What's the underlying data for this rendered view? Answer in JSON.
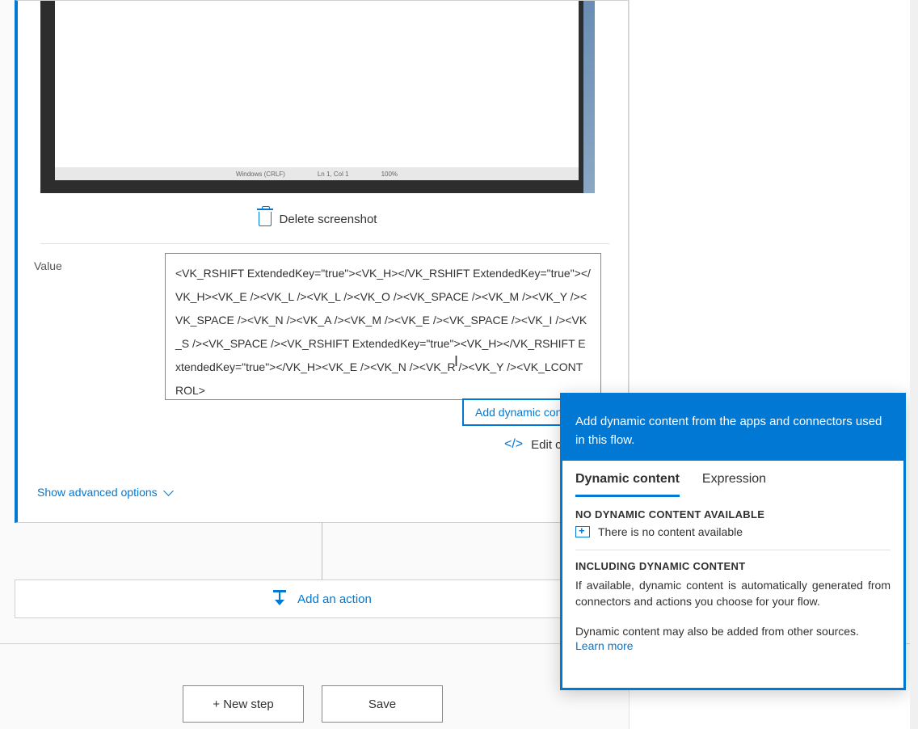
{
  "card": {
    "delete_label": "Delete screenshot",
    "value_label": "Value",
    "value_text": "<VK_RSHIFT ExtendedKey=\"true\"><VK_H></VK_RSHIFT ExtendedKey=\"true\"></VK_H><VK_E /><VK_L /><VK_L /><VK_O /><VK_SPACE /><VK_M /><VK_Y /><VK_SPACE /><VK_N /><VK_A /><VK_M /><VK_E /><VK_SPACE /><VK_I /><VK_S /><VK_SPACE /><VK_RSHIFT ExtendedKey=\"true\"><VK_H></VK_RSHIFT ExtendedKey=\"true\"></VK_H><VK_E /><VK_N /><VK_R /><VK_Y /><VK_LCONTROL>",
    "add_dynamic_content": "Add dynamic cont",
    "edit_code": "Edit co",
    "show_advanced": "Show advanced options",
    "screenshot_status_1": "Windows (CRLF)",
    "screenshot_status_2": "Ln 1, Col 1",
    "screenshot_status_3": "100%"
  },
  "actions": {
    "add_action": "Add an action",
    "new_step": "+ New step",
    "save": "Save"
  },
  "popup": {
    "header": "Add dynamic content from the apps and connectors used in this flow.",
    "tab_dynamic": "Dynamic content",
    "tab_expression": "Expression",
    "no_content_heading": "NO DYNAMIC CONTENT AVAILABLE",
    "no_content_text": "There is no content available",
    "including_heading": "INCLUDING DYNAMIC CONTENT",
    "including_text": "If available, dynamic content is automatically generated from connectors and actions you choose for your flow.",
    "other_sources": "Dynamic content may also be added from other sources.",
    "learn_more": "Learn more"
  }
}
